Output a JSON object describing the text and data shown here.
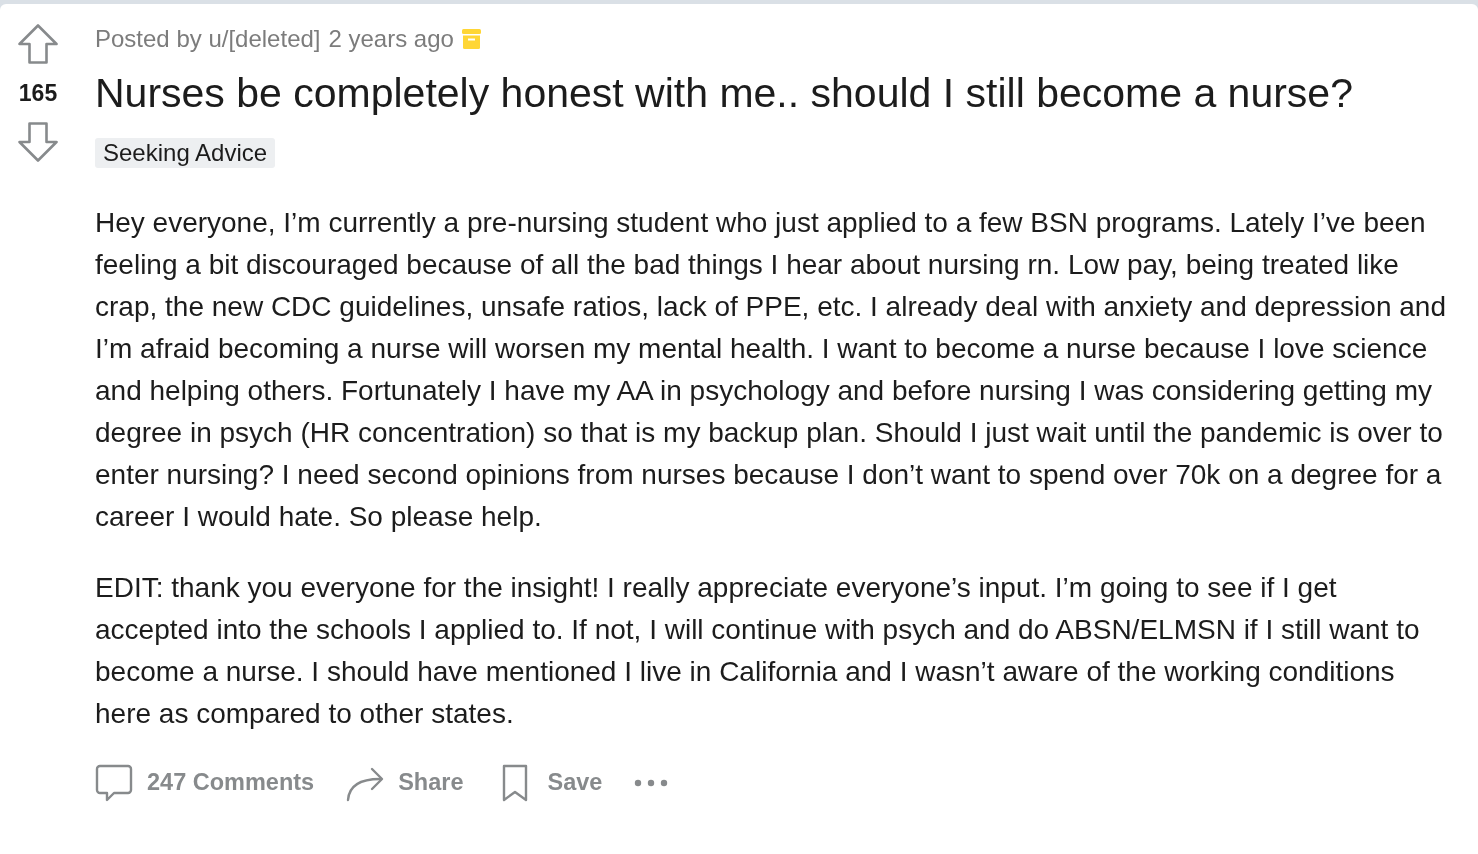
{
  "post": {
    "score": "165",
    "meta": {
      "posted_by": "Posted by u/[deleted]",
      "time": "2 years ago",
      "archived": true
    },
    "title": "Nurses be completely honest with me.. should I still become a nurse?",
    "flair": "Seeking Advice",
    "body": [
      "Hey everyone, I’m currently a pre-nursing student who just applied to a few BSN programs. Lately I’ve been feeling a bit discouraged because of all the bad things I hear about nursing rn. Low pay, being treated like crap, the new CDC guidelines, unsafe ratios, lack of PPE, etc. I already deal with anxiety and depression and I’m afraid becoming a nurse will worsen my mental health. I want to become a nurse because I love science and helping others. Fortunately I have my AA in psychology and before nursing I was considering getting my degree in psych (HR concentration) so that is my backup plan. Should I just wait until the pandemic is over to enter nursing? I need second opinions from nurses because I don’t want to spend over 70k on a degree for a career I would hate. So please help.",
      "EDIT: thank you everyone for the insight! I really appreciate everyone’s input. I’m going to see if I get accepted into the schools I applied to. If not, I will continue with psych and do ABSN/ELMSN if I still want to become a nurse. I should have mentioned I live in California and I wasn’t aware of the working conditions here as compared to other states."
    ],
    "actions": [
      {
        "kind": "comments",
        "label": "247 Comments"
      },
      {
        "kind": "share",
        "label": "Share"
      },
      {
        "kind": "save",
        "label": "Save"
      },
      {
        "kind": "more"
      }
    ]
  }
}
